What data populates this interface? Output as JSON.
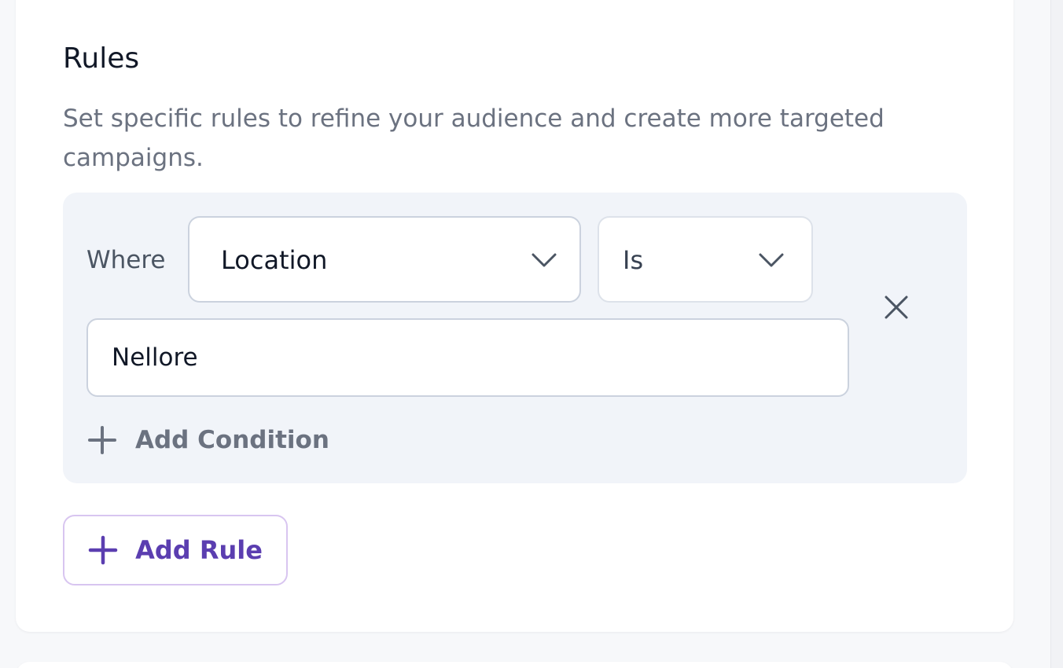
{
  "section": {
    "title": "Rules",
    "description": "Set specific rules to refine your audience and create more targeted campaigns."
  },
  "rule": {
    "where_label": "Where",
    "field_select": {
      "value": "Location"
    },
    "operator_select": {
      "value": "Is"
    },
    "value_input": {
      "value": "Nellore"
    },
    "add_condition_label": "Add Condition"
  },
  "actions": {
    "add_rule_label": "Add Rule"
  },
  "icons": {
    "chevron": "chevron-down-icon",
    "remove": "close-icon",
    "add": "plus-icon"
  },
  "colors": {
    "accent": "#5b3eb0",
    "accent_border": "#d8c5f0",
    "rule_box_bg": "#f1f4f9",
    "muted_text": "#6b7280"
  }
}
